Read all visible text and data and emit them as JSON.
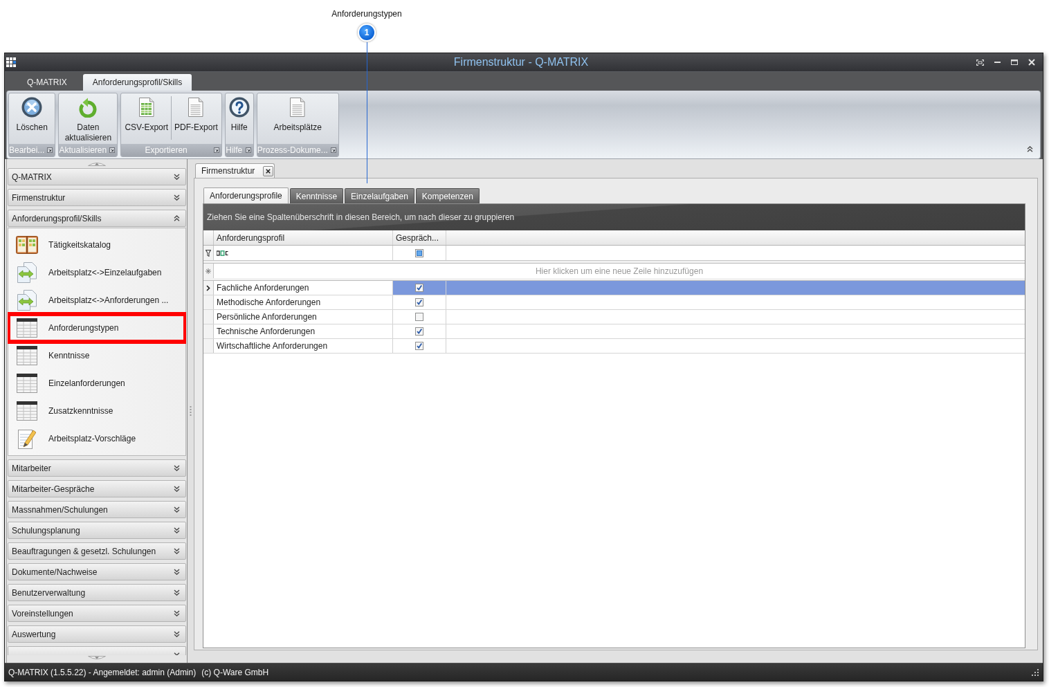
{
  "annotation": {
    "label": "Anforderungstypen",
    "number": "1"
  },
  "window": {
    "title": "Firmenstruktur - Q-MATRIX"
  },
  "ribbon": {
    "tabs": [
      {
        "label": "Q-MATRIX",
        "selected": false
      },
      {
        "label": "Anforderungsprofil/Skills",
        "selected": true
      }
    ],
    "groups": [
      {
        "label": "Bearbei...",
        "buttons": [
          {
            "label": "Löschen",
            "kind": "delete"
          }
        ]
      },
      {
        "label": "Aktualisieren",
        "buttons": [
          {
            "label": "Daten aktualisieren",
            "kind": "refresh"
          }
        ]
      },
      {
        "label": "Exportieren",
        "buttons": [
          {
            "label": "CSV-Export",
            "kind": "spreadsheet"
          },
          {
            "label": "PDF-Export",
            "kind": "document"
          }
        ]
      },
      {
        "label": "Hilfe",
        "buttons": [
          {
            "label": "Hilfe",
            "kind": "help"
          }
        ]
      },
      {
        "label": "Prozess-Dokume...",
        "buttons": [
          {
            "label": "Arbeitsplätze",
            "kind": "document"
          }
        ]
      }
    ]
  },
  "sidebar": {
    "groups": [
      {
        "label": "Q-MATRIX",
        "expanded": false
      },
      {
        "label": "Firmenstruktur",
        "expanded": false
      },
      {
        "label": "Anforderungsprofil/Skills",
        "expanded": true,
        "items": [
          {
            "label": "Tätigkeitskatalog",
            "kind": "catalog",
            "highlighted": false
          },
          {
            "label": "Arbeitsplatz<->Einzelaufgaben",
            "kind": "transfer",
            "highlighted": false
          },
          {
            "label": "Arbeitsplatz<->Anforderungen ...",
            "kind": "transfer",
            "highlighted": false
          },
          {
            "label": "Anforderungstypen",
            "kind": "table",
            "highlighted": true
          },
          {
            "label": "Kenntnisse",
            "kind": "table",
            "highlighted": false
          },
          {
            "label": "Einzelanforderungen",
            "kind": "table",
            "highlighted": false
          },
          {
            "label": "Zusatzkenntnisse",
            "kind": "table",
            "highlighted": false
          },
          {
            "label": "Arbeitsplatz-Vorschläge",
            "kind": "edit",
            "highlighted": false
          }
        ]
      },
      {
        "label": "Mitarbeiter",
        "expanded": false
      },
      {
        "label": "Mitarbeiter-Gespräche",
        "expanded": false
      },
      {
        "label": "Massnahmen/Schulungen",
        "expanded": false
      },
      {
        "label": "Schulungsplanung",
        "expanded": false
      },
      {
        "label": "Beauftragungen & gesetzl. Schulungen",
        "expanded": false
      },
      {
        "label": "Dokumente/Nachweise",
        "expanded": false
      },
      {
        "label": "Benutzerverwaltung",
        "expanded": false
      },
      {
        "label": "Voreinstellungen",
        "expanded": false
      },
      {
        "label": "Auswertung",
        "expanded": false
      },
      {
        "expanded": false
      }
    ]
  },
  "document_tabs": [
    {
      "label": "Firmenstruktur",
      "selected": true
    }
  ],
  "content_tabs": [
    {
      "label": "Anforderungsprofile",
      "selected": true
    },
    {
      "label": "Kenntnisse",
      "selected": false
    },
    {
      "label": "Einzelaufgaben",
      "selected": false
    },
    {
      "label": "Kompetenzen",
      "selected": false
    }
  ],
  "grid": {
    "group_panel_hint": "Ziehen Sie eine Spaltenüberschrift in diesen Bereich, um nach dieser zu gruppieren",
    "columns": [
      {
        "label": "Anforderungsprofil"
      },
      {
        "label": "Gespräch..."
      }
    ],
    "filter_row": {
      "checkbox_indeterminate": true
    },
    "new_row_hint": "Hier klicken um eine neue Zeile hinzuzufügen",
    "rows": [
      {
        "anforderungsprofil": "Fachliche Anforderungen",
        "checked": true,
        "selected": true
      },
      {
        "anforderungsprofil": "Methodische Anforderungen",
        "checked": true,
        "selected": false
      },
      {
        "anforderungsprofil": "Persönliche Anforderungen",
        "checked": false,
        "selected": false
      },
      {
        "anforderungsprofil": "Technische Anforderungen",
        "checked": true,
        "selected": false
      },
      {
        "anforderungsprofil": "Wirtschaftliche Anforderungen",
        "checked": true,
        "selected": false
      }
    ]
  },
  "status_bar": {
    "text": "Q-MATRIX (1.5.5.22) - Angemeldet: admin (Admin)",
    "copyright": "(c) Q-Ware GmbH"
  }
}
